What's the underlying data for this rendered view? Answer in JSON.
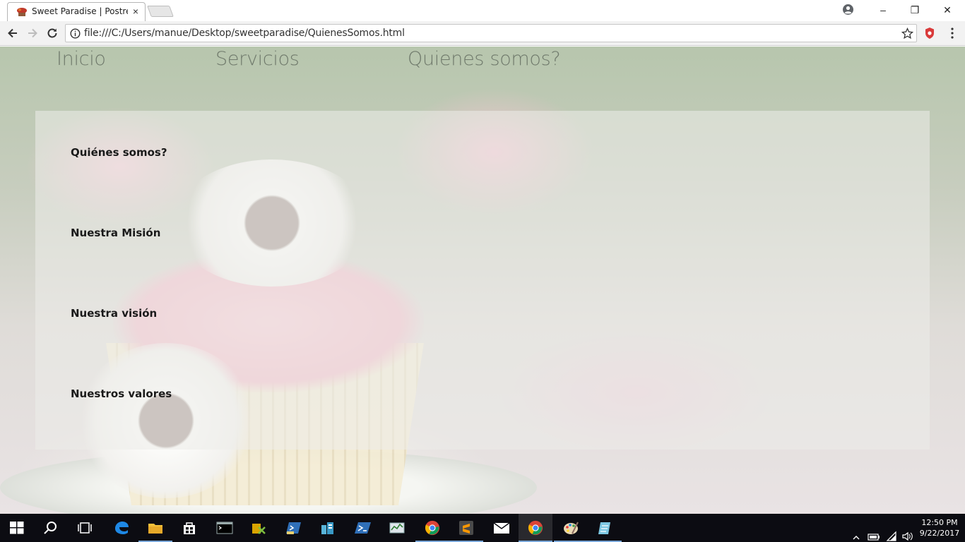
{
  "browser": {
    "tab": {
      "title": "Sweet Paradise | Postres",
      "close_glyph": "×"
    },
    "url": "file:///C:/Users/manue/Desktop/sweetparadise/QuienesSomos.html",
    "window_controls": {
      "minimize": "–",
      "restore": "❐",
      "close": "✕"
    }
  },
  "page": {
    "nav": [
      {
        "label": "Inicio"
      },
      {
        "label": "Servicios"
      },
      {
        "label": "Quienes somos?"
      }
    ],
    "sections": [
      {
        "heading": "Quiénes somos?"
      },
      {
        "heading": "Nuestra Misión"
      },
      {
        "heading": "Nuestra visión"
      },
      {
        "heading": "Nuestros valores"
      }
    ]
  },
  "taskbar": {
    "apps": [
      "start",
      "search",
      "task-view",
      "edge",
      "file-explorer",
      "store",
      "cmd",
      "tool",
      "powershell-ise",
      "azure",
      "powershell",
      "task-manager",
      "chrome",
      "sublime",
      "mail",
      "chrome-active",
      "paint",
      "notes"
    ],
    "clock": {
      "time": "12:50 PM",
      "date": "9/22/2017"
    }
  }
}
